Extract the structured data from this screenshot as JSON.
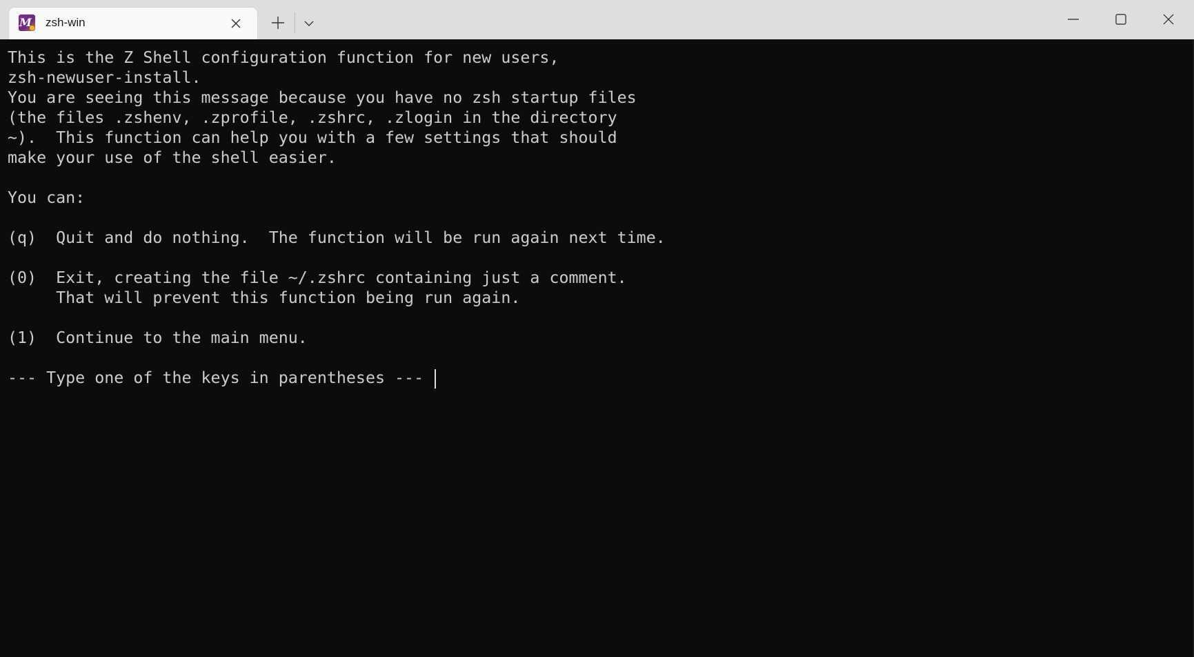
{
  "window": {
    "tab_title": "zsh-win",
    "tab_icon_letter": "M"
  },
  "terminal": {
    "lines": [
      "This is the Z Shell configuration function for new users,",
      "zsh-newuser-install.",
      "You are seeing this message because you have no zsh startup files",
      "(the files .zshenv, .zprofile, .zshrc, .zlogin in the directory",
      "~).  This function can help you with a few settings that should",
      "make your use of the shell easier.",
      "",
      "You can:",
      "",
      "(q)  Quit and do nothing.  The function will be run again next time.",
      "",
      "(0)  Exit, creating the file ~/.zshrc containing just a comment.",
      "     That will prevent this function being run again.",
      "",
      "(1)  Continue to the main menu.",
      "",
      "--- Type one of the keys in parentheses --- "
    ]
  },
  "icons": {
    "tab_close": "close-icon",
    "new_tab": "plus-icon",
    "dropdown": "chevron-down-icon",
    "minimize": "minimize-icon",
    "maximize": "maximize-icon",
    "close": "close-icon"
  },
  "colors": {
    "terminal_bg": "#0c0c0c",
    "terminal_fg": "#cccccc",
    "titlebar_bg": "#dedede",
    "tab_bg": "#f9f9f9"
  }
}
